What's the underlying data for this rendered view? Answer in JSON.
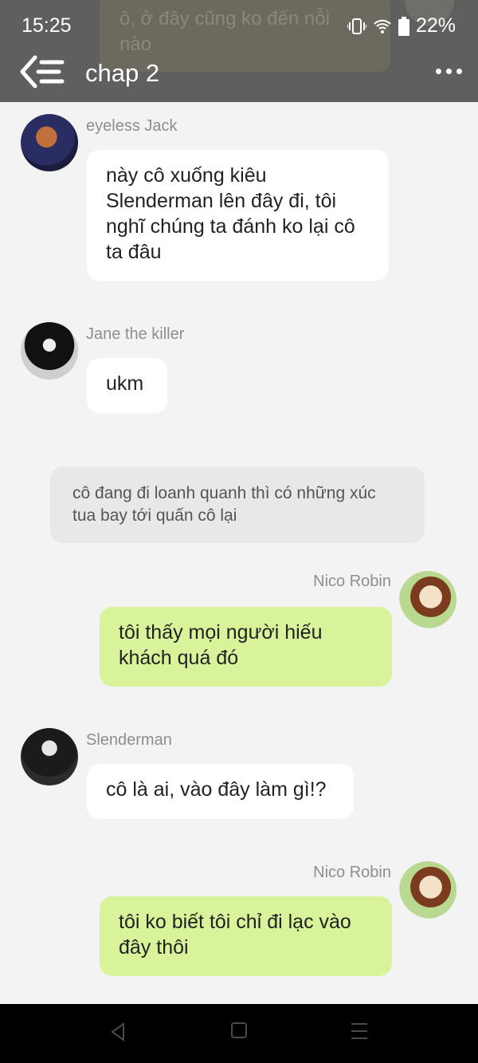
{
  "status_bar": {
    "time": "15:25",
    "battery": "22%"
  },
  "header": {
    "title": "chap 2",
    "ghost_message": "ô, ở đây cũng ko đến nỗi nào"
  },
  "messages": [
    {
      "side": "left",
      "name": "eyeless Jack",
      "text": "này cô xuống kiêu Slenderman lên đây đi, tôi nghĩ chúng ta đánh ko lại cô ta đâu"
    },
    {
      "side": "left",
      "name": "Jane the killer",
      "text": "ukm"
    },
    {
      "type": "narration",
      "text": "cô đang đi loanh quanh thì có những xúc tua bay tới quấn cô lại"
    },
    {
      "side": "right",
      "name": "Nico Robin",
      "text": "tôi thấy mọi người hiếu khách quá đó"
    },
    {
      "side": "left",
      "name": "Slenderman",
      "text": "cô là ai, vào đây làm gì!?"
    },
    {
      "side": "right",
      "name": "Nico Robin",
      "text": "tôi ko biết tôi chỉ đi lạc vào đây thôi"
    }
  ],
  "colors": {
    "header": "#5f5f5f",
    "left_bubble": "#ffffff",
    "right_bubble": "#d9f39b",
    "background": "#f3f3f3"
  },
  "icons": [
    "back-list-icon",
    "more-dots-icon",
    "vibrate-icon",
    "wifi-icon",
    "battery-icon",
    "nav-back-icon",
    "nav-home-icon",
    "nav-menu-icon"
  ]
}
